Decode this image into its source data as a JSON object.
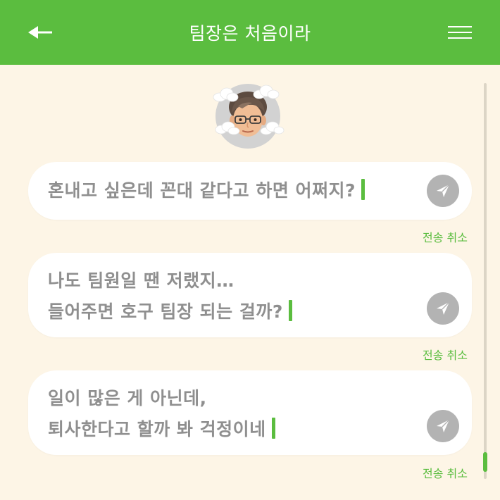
{
  "header": {
    "title": "팀장은 처음이라",
    "back_icon": "arrow-left-icon",
    "menu_icon": "hamburger-menu-icon",
    "background_color": "#5bbd3f"
  },
  "avatar": {
    "icon": "memoji-avatar-icon"
  },
  "messages": [
    {
      "text": "혼내고 싶은데 꼰대 같다고 하면 어쩌지?",
      "cancel_label": "전송 취소",
      "send_icon": "paper-plane-icon"
    },
    {
      "text": "나도 팀원일 땐 저랬지…\n들어주면 호구 팀장 되는 걸까?",
      "cancel_label": "전송 취소",
      "send_icon": "paper-plane-icon"
    },
    {
      "text": "일이 많은 게 아닌데,\n퇴사한다고 할까 봐 걱정이네",
      "cancel_label": "전송 취소",
      "send_icon": "paper-plane-icon"
    }
  ],
  "colors": {
    "accent": "#5bbd3f",
    "background": "#fdf5e6",
    "bubble_text": "#8f8f8f",
    "send_button": "#b3b3b3"
  }
}
